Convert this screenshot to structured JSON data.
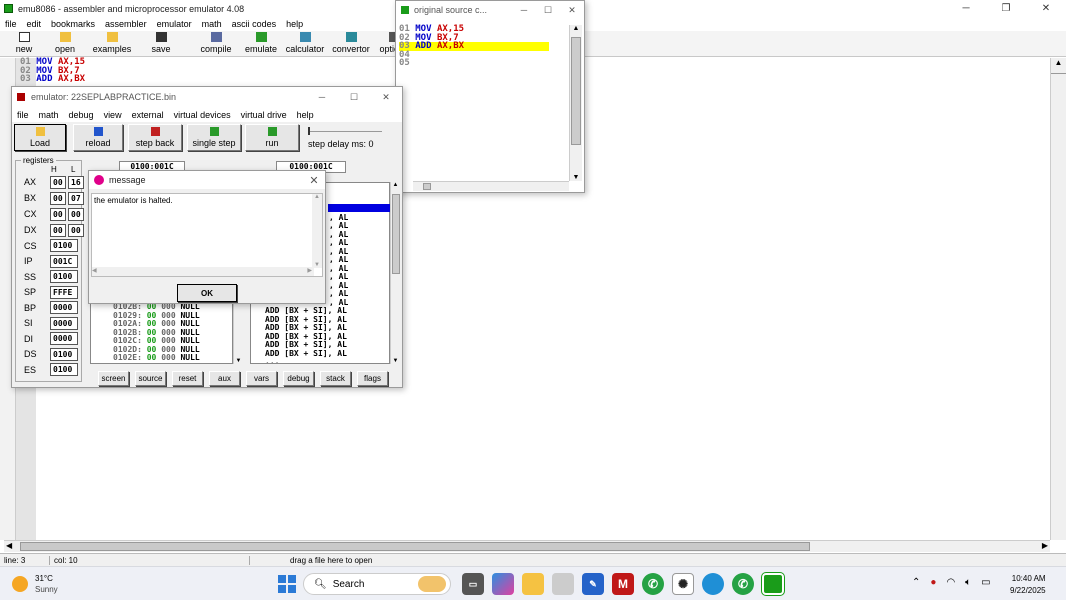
{
  "main_window": {
    "title": "emu8086 - assembler and microprocessor emulator 4.08",
    "menu": [
      "file",
      "edit",
      "bookmarks",
      "assembler",
      "emulator",
      "math",
      "ascii codes",
      "help"
    ],
    "toolbar": [
      "new",
      "open",
      "examples",
      "save",
      "compile",
      "emulate",
      "calculator",
      "convertor",
      "options"
    ],
    "code_lines": [
      {
        "num": "01",
        "op": "MOV",
        "args": "AX,15"
      },
      {
        "num": "02",
        "op": "MOV",
        "args": "BX,7"
      },
      {
        "num": "03",
        "op": "ADD",
        "args": "AX,BX"
      }
    ],
    "status": {
      "line": "line: 3",
      "col": "col: 10",
      "hint": "drag a file here to open"
    }
  },
  "emulator_window": {
    "title": "emulator: 22SEPLABPRACTICE.bin",
    "menu": [
      "file",
      "math",
      "debug",
      "view",
      "external",
      "virtual devices",
      "virtual drive",
      "help"
    ],
    "toolbar": [
      "Load",
      "reload",
      "step back",
      "single step",
      "run"
    ],
    "step_delay": "step delay ms: 0",
    "registers_label": "registers",
    "h_label": "H",
    "l_label": "L",
    "address_left": "0100:001C",
    "address_right": "0100:001C",
    "registers_hl": [
      {
        "name": "AX",
        "h": "00",
        "l": "16"
      },
      {
        "name": "BX",
        "h": "00",
        "l": "07"
      },
      {
        "name": "CX",
        "h": "00",
        "l": "00"
      },
      {
        "name": "DX",
        "h": "00",
        "l": "00"
      }
    ],
    "registers_16": [
      {
        "name": "CS",
        "value": "0100"
      },
      {
        "name": "IP",
        "value": "001C"
      },
      {
        "name": "SS",
        "value": "0100"
      },
      {
        "name": "SP",
        "value": "FFFE"
      },
      {
        "name": "BP",
        "value": "0000"
      },
      {
        "name": "SI",
        "value": "0000"
      },
      {
        "name": "DI",
        "value": "0000"
      },
      {
        "name": "DS",
        "value": "0100"
      },
      {
        "name": "ES",
        "value": "0100"
      }
    ],
    "memory_rows": [
      {
        "addr": "0102B:",
        "b1": "00",
        "b2": "000",
        "sym": "NULL"
      },
      {
        "addr": "01029:",
        "b1": "00",
        "b2": "000",
        "sym": "NULL"
      },
      {
        "addr": "0102A:",
        "b1": "00",
        "b2": "000",
        "sym": "NULL"
      },
      {
        "addr": "0102B:",
        "b1": "00",
        "b2": "000",
        "sym": "NULL"
      },
      {
        "addr": "0102C:",
        "b1": "00",
        "b2": "000",
        "sym": "NULL"
      },
      {
        "addr": "0102D:",
        "b1": "00",
        "b2": "000",
        "sym": "NULL"
      },
      {
        "addr": "0102E:",
        "b1": "00",
        "b2": "000",
        "sym": "NULL"
      }
    ],
    "disasm_partial": [
      ", AL",
      ", AL",
      ", AL",
      ", AL",
      ", AL",
      ", AL",
      ", AL",
      ", AL",
      ", AL",
      ", AL",
      ", AL",
      ", AL"
    ],
    "disasm_rows": [
      "ADD [BX + SI], AL",
      "ADD [BX + SI], AL",
      "ADD [BX + SI], AL",
      "ADD [BX + SI], AL",
      "ADD [BX + SI], AL",
      "ADD [BX + SI], AL",
      "..."
    ],
    "bottom_buttons": [
      "screen",
      "source",
      "reset",
      "aux",
      "vars",
      "debug",
      "stack",
      "flags"
    ]
  },
  "source_window": {
    "title": "original source c...",
    "lines": [
      {
        "num": "01",
        "op": "MOV",
        "args": "AX,15"
      },
      {
        "num": "02",
        "op": "MOV",
        "args": "BX,7"
      },
      {
        "num": "03",
        "op": "ADD",
        "args": "AX,BX"
      },
      {
        "num": "04",
        "op": "",
        "args": ""
      },
      {
        "num": "05",
        "op": "",
        "args": ""
      }
    ]
  },
  "message_dialog": {
    "title": "message",
    "text": "the emulator is halted.",
    "ok": "OK"
  },
  "taskbar": {
    "temperature": "31°C",
    "weather": "Sunny",
    "search": "Search",
    "time": "10:40 AM",
    "date": "9/22/2025"
  }
}
